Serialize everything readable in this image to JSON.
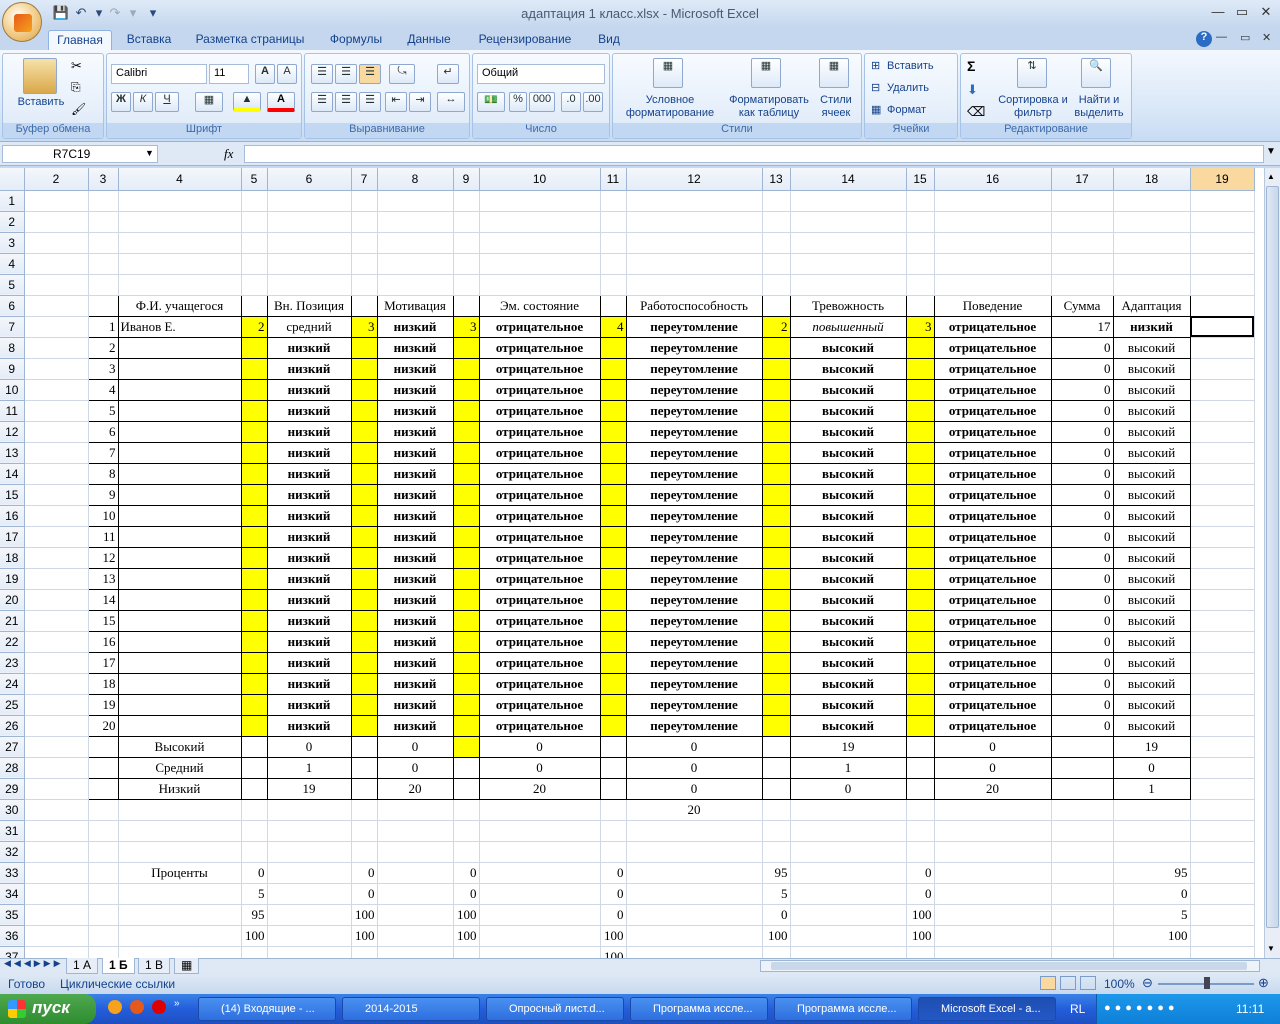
{
  "window": {
    "title": "адаптация 1 класс.xlsx - Microsoft Excel"
  },
  "tabs": [
    "Главная",
    "Вставка",
    "Разметка страницы",
    "Формулы",
    "Данные",
    "Рецензирование",
    "Вид"
  ],
  "ribbon": {
    "clipboard": {
      "label": "Буфер обмена",
      "paste": "Вставить"
    },
    "font": {
      "label": "Шрифт",
      "name": "Calibri",
      "size": "11",
      "bold": "Ж",
      "italic": "К",
      "underline": "Ч"
    },
    "alignment": {
      "label": "Выравнивание"
    },
    "number": {
      "label": "Число",
      "format": "Общий",
      "percent": "%",
      "thousands": "000"
    },
    "styles": {
      "label": "Стили",
      "conditional": "Условное форматирование",
      "as_table": "Форматировать как таблицу",
      "cell_styles": "Стили ячеек"
    },
    "cells": {
      "label": "Ячейки",
      "insert": "Вставить",
      "delete": "Удалить",
      "format": "Формат"
    },
    "editing": {
      "label": "Редактирование",
      "sort": "Сортировка и фильтр",
      "find": "Найти и выделить"
    }
  },
  "formula_bar": {
    "name_box": "R7C19",
    "fx": "fx",
    "value": ""
  },
  "columns": [
    "2",
    "3",
    "4",
    "5",
    "6",
    "7",
    "8",
    "9",
    "10",
    "11",
    "12",
    "13",
    "14",
    "15",
    "16",
    "17",
    "18",
    "19"
  ],
  "selected_column": "19",
  "headers": {
    "c4": "Ф.И. учащегося",
    "c6": "Вн. Позиция",
    "c8": "Мотивация",
    "c10": "Эм. состояние",
    "c12": "Работоспособность",
    "c14": "Тревожность",
    "c16": "Поведение",
    "c17": "Сумма",
    "c18": "Адаптация"
  },
  "first_row": {
    "n": "1",
    "name": "Иванов Е.",
    "s5": "2",
    "c6": "средний",
    "s7": "3",
    "c8": "низкий",
    "s9": "3",
    "c10": "отрицательное",
    "s11": "4",
    "c12": "переутомление",
    "s13": "2",
    "c14": "повышенный",
    "s15": "3",
    "c16": "отрицательное",
    "c17": "17",
    "c18": "низкий"
  },
  "repeat_row": {
    "c6": "низкий",
    "c8": "низкий",
    "c10": "отрицательное",
    "c12": "переутомление",
    "c14": "высокий",
    "c16": "отрицательное",
    "c17": "0",
    "c18": "высокий"
  },
  "summary": [
    {
      "label": "Высокий",
      "c6": "0",
      "c8": "0",
      "c10": "0",
      "c12": "0",
      "c14": "19",
      "c16": "0",
      "c18": "19"
    },
    {
      "label": "Средний",
      "c6": "1",
      "c8": "0",
      "c10": "0",
      "c12": "0",
      "c14": "1",
      "c16": "0",
      "c18": "0"
    },
    {
      "label": "Низкий",
      "c6": "19",
      "c8": "20",
      "c10": "20",
      "c12": "0",
      "c14": "0",
      "c16": "20",
      "c18": "1"
    }
  ],
  "row30_c12": "20",
  "percents_label": "Проценты",
  "percents": [
    {
      "row": "33",
      "c5": "0",
      "c7": "0",
      "c9": "0",
      "c11": "0",
      "c13": "95",
      "c15": "0",
      "c18": "95"
    },
    {
      "row": "34",
      "c5": "5",
      "c7": "0",
      "c9": "0",
      "c11": "0",
      "c13": "5",
      "c15": "0",
      "c18": "0"
    },
    {
      "row": "35",
      "c5": "95",
      "c7": "100",
      "c9": "100",
      "c11": "0",
      "c13": "0",
      "c15": "100",
      "c18": "5"
    },
    {
      "row": "36",
      "c5": "100",
      "c7": "100",
      "c9": "100",
      "c11": "100",
      "c13": "100",
      "c15": "100",
      "c18": "100"
    },
    {
      "row": "37",
      "c11": "100"
    }
  ],
  "sheets": [
    {
      "name": "1 А"
    },
    {
      "name": "1 Б",
      "active": true
    },
    {
      "name": "1 В"
    }
  ],
  "status": {
    "ready": "Готово",
    "circular": "Циклические ссылки",
    "zoom": "100%"
  },
  "taskbar": {
    "start": "пуск",
    "buttons": [
      "(14) Входящие - ...",
      "2014-2015",
      "Опросный лист.d...",
      "Программа иссле...",
      "Программа иссле...",
      "Microsoft Excel - а..."
    ],
    "lang": "RL",
    "clock": "11:11"
  }
}
